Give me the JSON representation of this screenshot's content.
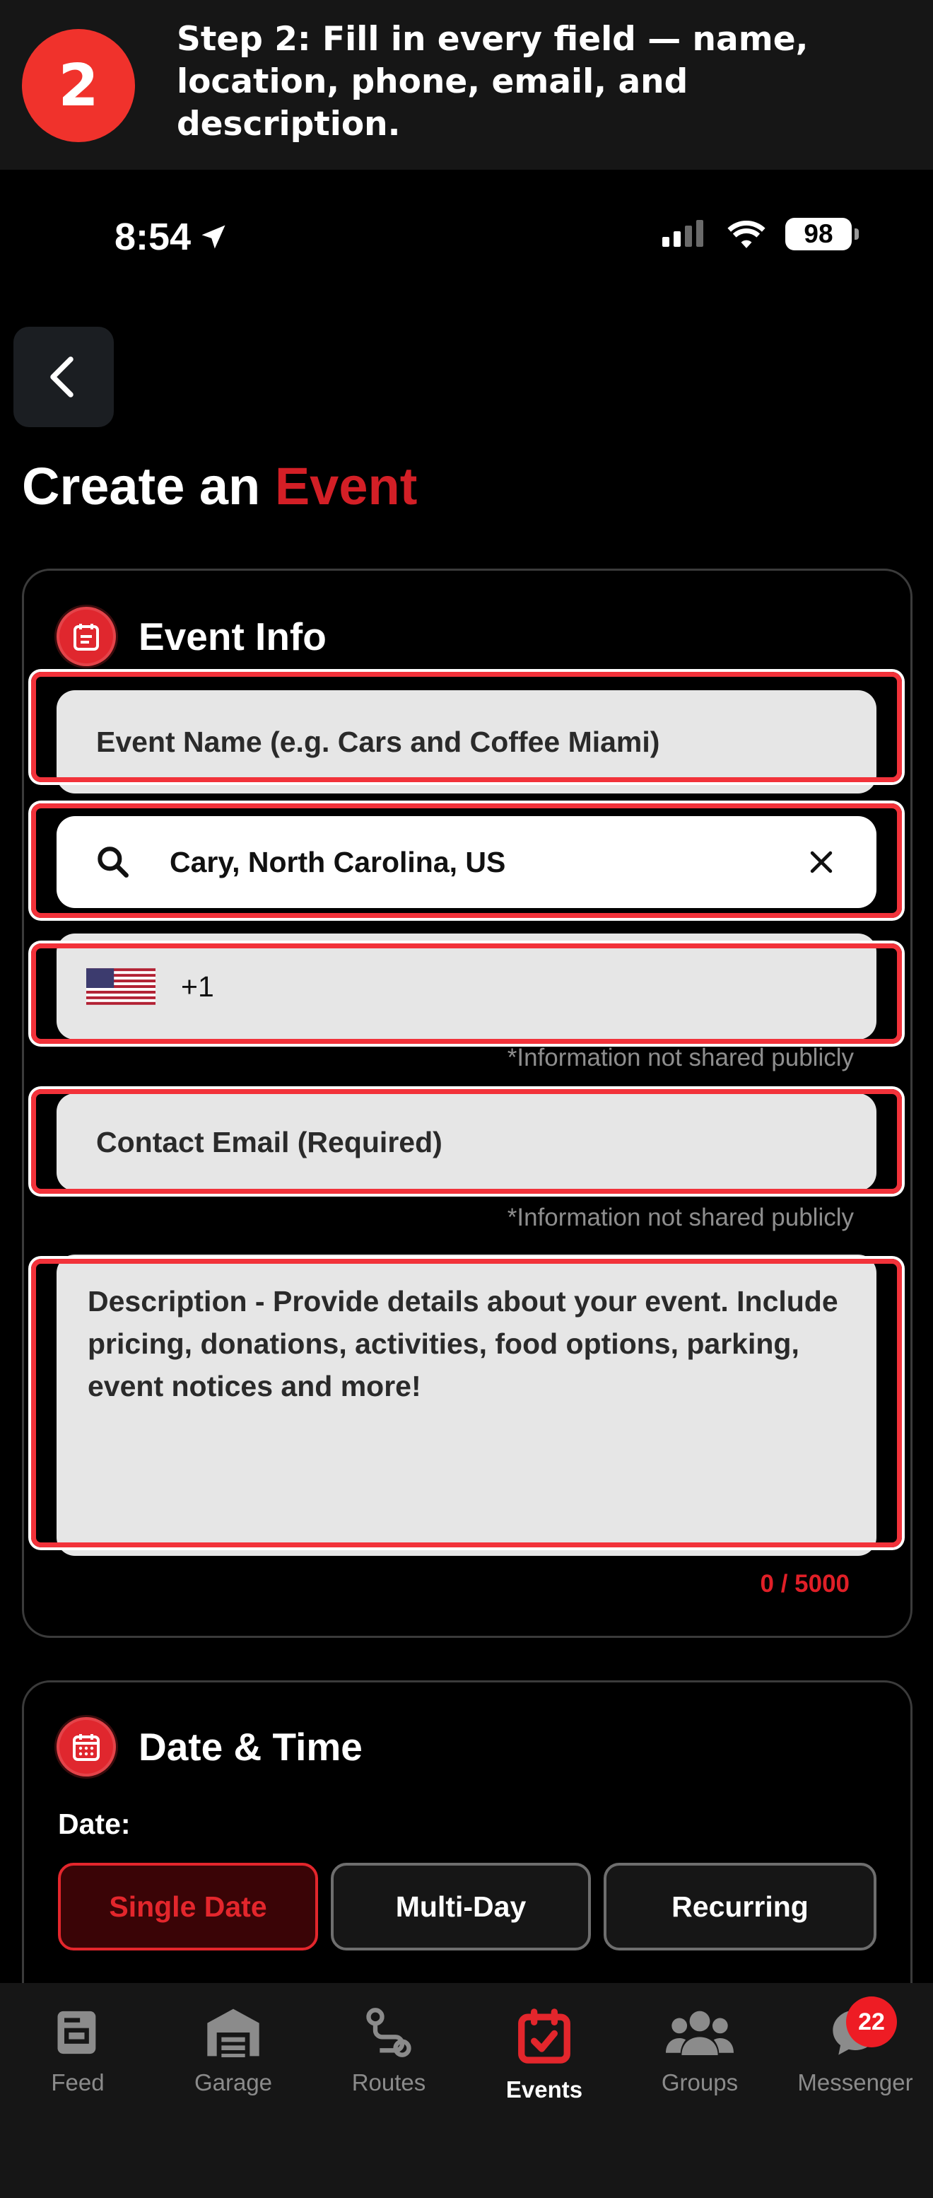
{
  "banner": {
    "step_number": "2",
    "text": "Step 2: Fill in every field — name, location, phone, email, and description."
  },
  "status_bar": {
    "time": "8:54",
    "battery": "98"
  },
  "header": {
    "title_main": "Create an",
    "title_accent": "Event"
  },
  "event_info": {
    "heading": "Event Info",
    "name_placeholder": "Event Name (e.g. Cars and Coffee Miami)",
    "location_value": "Cary, North Carolina, US",
    "phone_code": "+1",
    "phone_hint": "*Information not shared publicly",
    "email_placeholder": "Contact Email (Required)",
    "email_hint": "*Information not shared publicly",
    "description_placeholder": "Description - Provide details about your event. Include pricing, donations, activities, food options, parking, event notices and more!",
    "counter": "0 / 5000"
  },
  "date_time": {
    "heading": "Date & Time",
    "date_label": "Date:",
    "options": [
      "Single Date",
      "Multi-Day",
      "Recurring"
    ],
    "selected": "Single Date"
  },
  "tabbar": {
    "tabs": [
      {
        "label": "Feed",
        "icon": "feed-icon"
      },
      {
        "label": "Garage",
        "icon": "garage-icon"
      },
      {
        "label": "Routes",
        "icon": "routes-icon"
      },
      {
        "label": "Events",
        "icon": "events-icon"
      },
      {
        "label": "Groups",
        "icon": "groups-icon"
      },
      {
        "label": "Messenger",
        "icon": "messenger-icon"
      }
    ],
    "active": "Events",
    "messenger_badge": "22"
  },
  "colors": {
    "accent": "#d31f26",
    "highlight": "#f2323a",
    "background": "#000000"
  }
}
